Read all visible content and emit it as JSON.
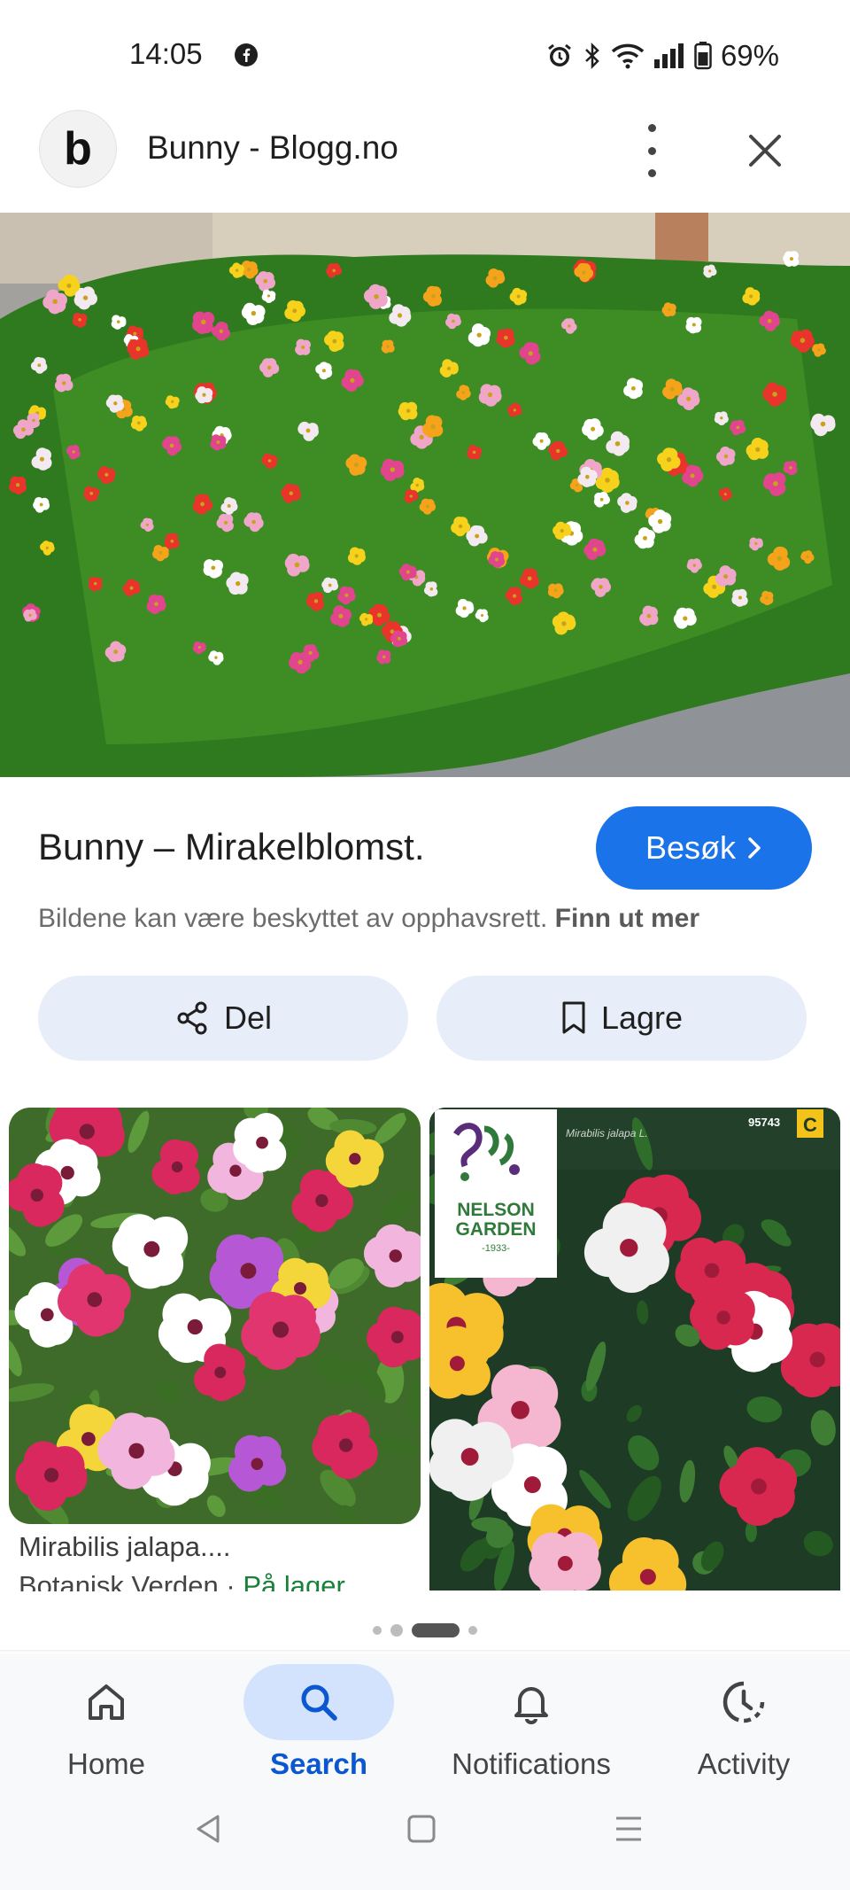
{
  "status_bar": {
    "time": "14:05",
    "battery": "69%"
  },
  "header": {
    "logo_letter": "b",
    "title": "Bunny - Blogg.no"
  },
  "result": {
    "title": "Bunny – Mirakelblomst.",
    "visit_label": "Besøk",
    "copyright_text": "Bildene kan være beskyttet av opphavsrett.",
    "copyright_link": "Finn ut mer"
  },
  "actions": {
    "share_label": "Del",
    "save_label": "Lagre"
  },
  "related": [
    {
      "title": "Mirabilis jalapa....",
      "source": "Botanisk Verden",
      "separator": " · ",
      "stock": "På lager"
    },
    {
      "packet_brand": "NELSON",
      "packet_brand2": "GARDEN",
      "packet_year": "-1933-",
      "packet_species": "Mirabilis jalapa L.",
      "packet_code": "95743",
      "packet_grade": "C"
    }
  ],
  "bottom_nav": [
    {
      "label": "Home",
      "icon": "home-icon"
    },
    {
      "label": "Search",
      "icon": "search-icon",
      "active": true
    },
    {
      "label": "Notifications",
      "icon": "bell-icon"
    },
    {
      "label": "Activity",
      "icon": "activity-icon"
    }
  ],
  "colors": {
    "accent": "#1a73e8",
    "pill_bg": "#e8eef9",
    "nav_active": "#d3e3fd",
    "stock_green": "#188038"
  }
}
